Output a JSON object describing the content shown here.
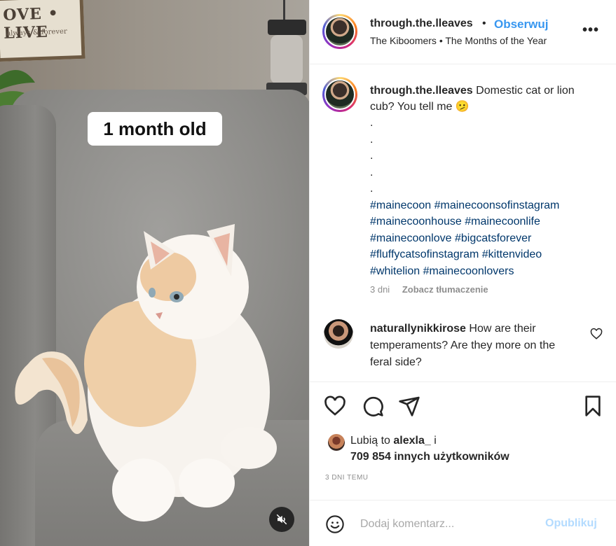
{
  "media": {
    "overlay_label": "1 month old",
    "sign_text": "OVE • LIVE",
    "sign_subtext": "always & forever",
    "mute_icon": "speaker-muted-icon"
  },
  "header": {
    "username": "through.the.lleaves",
    "separator": "•",
    "follow_label": "Obserwuj",
    "music": "The Kiboomers • The Months of the Year",
    "more_label": "•••"
  },
  "caption": {
    "username": "through.the.lleaves",
    "text": "Domestic cat or lion cub? You tell me",
    "emoji": "🫤",
    "dots": [
      ".",
      ".",
      ".",
      ".",
      "."
    ],
    "hashtags": [
      "#mainecoon #mainecoonsofinstagram",
      "#mainecoonhouse #mainecoonlife",
      "#mainecoonlove #bigcatsforever",
      "#fluffycatsofinstagram #kittenvideo",
      "#whitelion #mainecoonlovers"
    ],
    "age": "3 dni",
    "translate": "Zobacz tłumaczenie"
  },
  "comment": {
    "username": "naturallynikkirose",
    "text": "How are their temperaments? Are they more on the feral side?"
  },
  "actions": {
    "likes_prefix": "Lubią to",
    "likes_user": "alexla_",
    "likes_conj": "i",
    "likes_count": "709 854 innych użytkowników",
    "timestamp": "3 DNI TEMU"
  },
  "composer": {
    "placeholder": "Dodaj komentarz...",
    "publish_label": "Opublikuj"
  },
  "colors": {
    "link": "#3897f0",
    "hashtag": "#00376b",
    "muted": "#8e8e8e",
    "publish_disabled": "#b3dbff"
  }
}
